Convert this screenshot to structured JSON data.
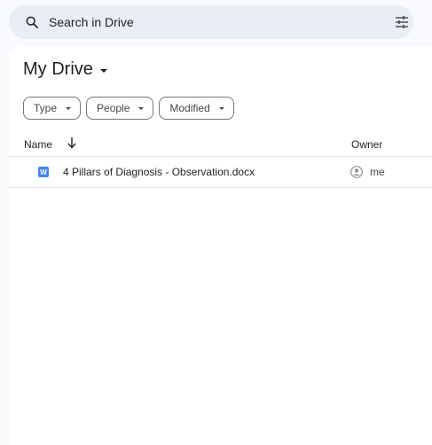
{
  "search": {
    "placeholder": "Search in Drive"
  },
  "page": {
    "title": "My Drive"
  },
  "filters": [
    {
      "label": "Type"
    },
    {
      "label": "People"
    },
    {
      "label": "Modified"
    }
  ],
  "columns": {
    "name": "Name",
    "owner": "Owner"
  },
  "files": [
    {
      "name": "4 Pillars of Diagnosis - Observation.docx",
      "type_badge": "W",
      "owner": "me"
    }
  ],
  "icons": {
    "search": "search-icon",
    "filter": "tune-icon",
    "sort": "arrow-down-icon",
    "file": "word-doc-icon",
    "owner": "account-circle-icon"
  },
  "colors": {
    "background": "#f8fafd",
    "search_bg": "#e9eef6",
    "word_blue": "#4285f4"
  }
}
